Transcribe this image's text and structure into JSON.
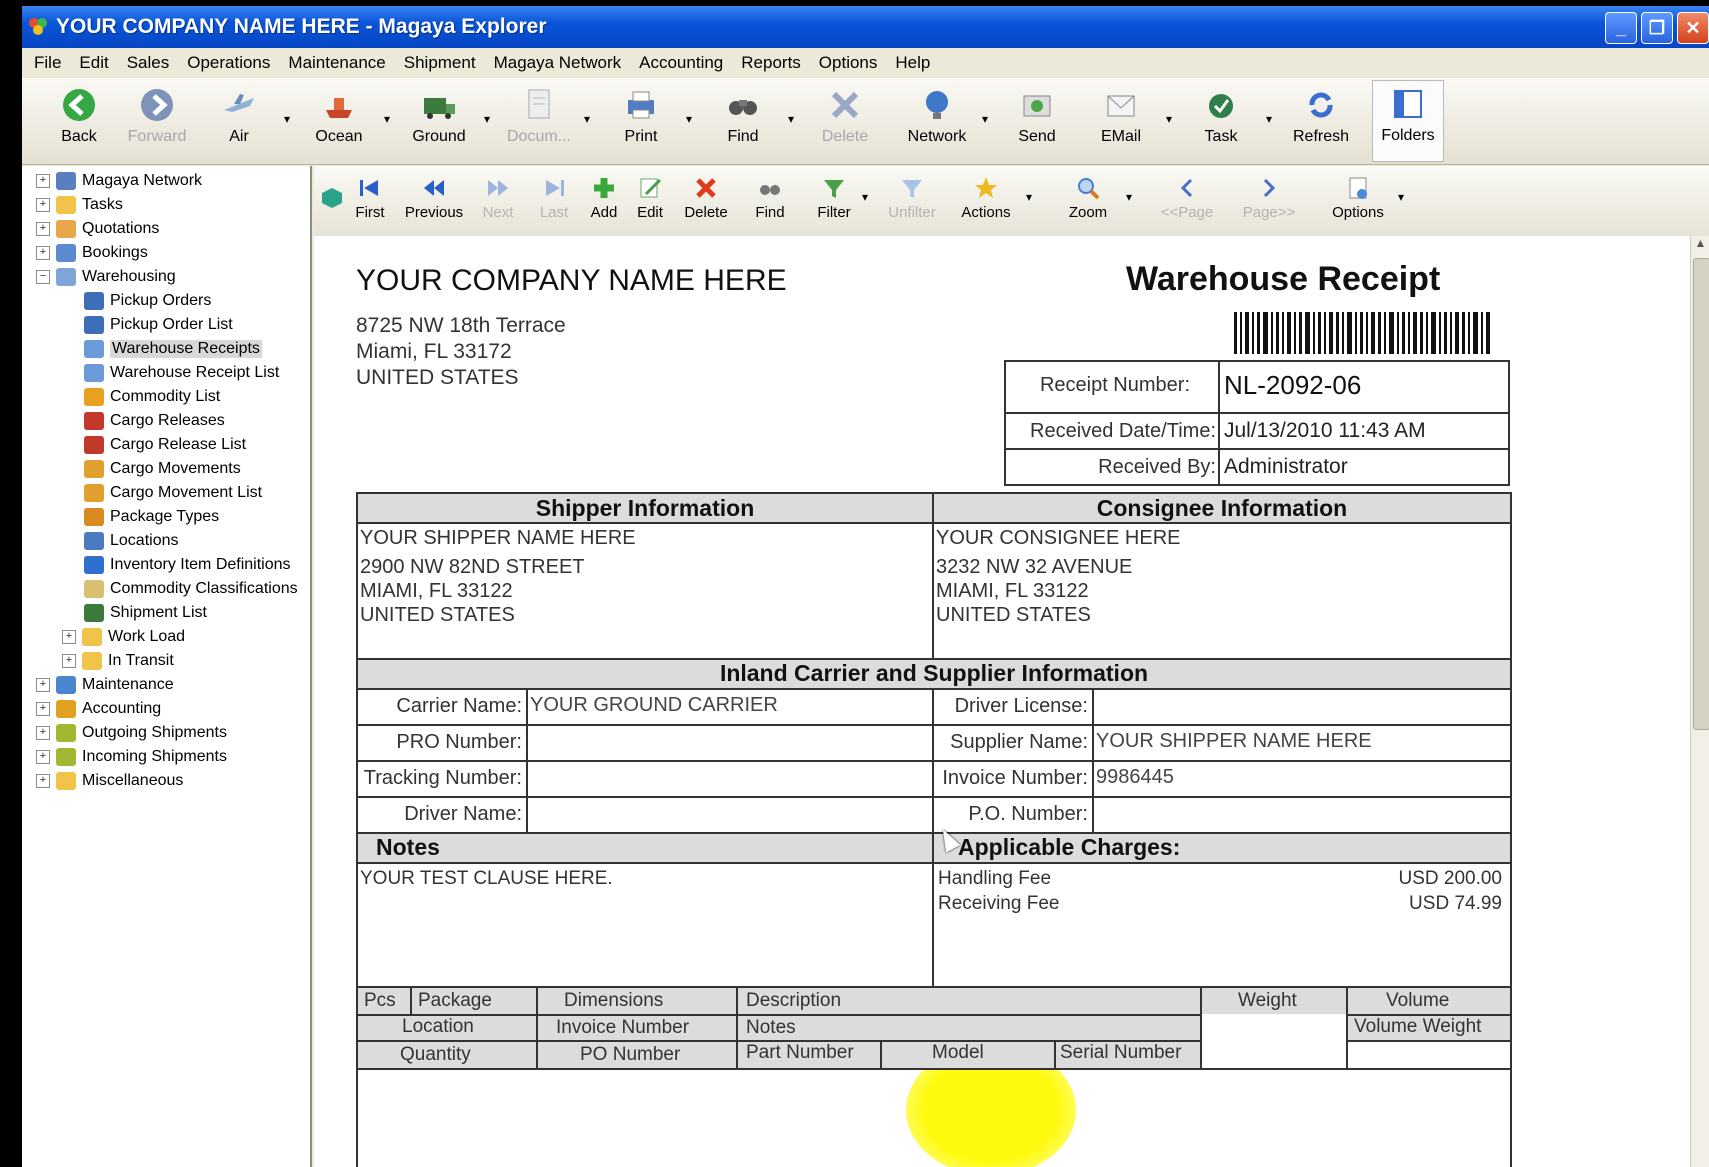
{
  "window": {
    "title": "YOUR COMPANY NAME HERE - Magaya Explorer"
  },
  "menu": [
    "File",
    "Edit",
    "Sales",
    "Operations",
    "Maintenance",
    "Shipment",
    "Magaya Network",
    "Accounting",
    "Reports",
    "Options",
    "Help"
  ],
  "toolbar": {
    "back": "Back",
    "forward": "Forward",
    "air": "Air",
    "ocean": "Ocean",
    "ground": "Ground",
    "documents": "Docum...",
    "print": "Print",
    "find": "Find",
    "delete": "Delete",
    "network": "Network",
    "send": "Send",
    "email": "EMail",
    "task": "Task",
    "refresh": "Refresh",
    "folders": "Folders"
  },
  "sidebar": {
    "items": [
      {
        "label": "Magaya Network"
      },
      {
        "label": "Tasks"
      },
      {
        "label": "Quotations"
      },
      {
        "label": "Bookings"
      },
      {
        "label": "Warehousing"
      },
      {
        "label": "Pickup Orders"
      },
      {
        "label": "Pickup Order List"
      },
      {
        "label": "Warehouse Receipts"
      },
      {
        "label": "Warehouse Receipt List"
      },
      {
        "label": "Commodity List"
      },
      {
        "label": "Cargo Releases"
      },
      {
        "label": "Cargo Release List"
      },
      {
        "label": "Cargo Movements"
      },
      {
        "label": "Cargo Movement List"
      },
      {
        "label": "Package Types"
      },
      {
        "label": "Locations"
      },
      {
        "label": "Inventory Item Definitions"
      },
      {
        "label": "Commodity Classifications"
      },
      {
        "label": "Shipment List"
      },
      {
        "label": "Work Load"
      },
      {
        "label": "In Transit"
      },
      {
        "label": "Maintenance"
      },
      {
        "label": "Accounting"
      },
      {
        "label": "Outgoing Shipments"
      },
      {
        "label": "Incoming Shipments"
      },
      {
        "label": "Miscellaneous"
      }
    ]
  },
  "report_toolbar": {
    "first": "First",
    "previous": "Previous",
    "next": "Next",
    "last": "Last",
    "add": "Add",
    "edit": "Edit",
    "delete": "Delete",
    "find": "Find",
    "filter": "Filter",
    "unfilter": "Unfilter",
    "actions": "Actions",
    "zoom": "Zoom",
    "prev_page": "<<Page",
    "next_page": "Page>>",
    "options": "Options"
  },
  "document": {
    "company_name": "YOUR COMPANY NAME HERE",
    "company_addr1": "8725 NW 18th Terrace",
    "company_addr2": "Miami, FL 33172",
    "company_addr3": "UNITED STATES",
    "title": "Warehouse Receipt",
    "receipt_number_label": "Receipt Number:",
    "receipt_number": "NL-2092-06",
    "received_dt_label": "Received Date/Time:",
    "received_dt": "Jul/13/2010  11:43 AM",
    "received_by_label": "Received By:",
    "received_by": "Administrator",
    "shipper_title": "Shipper Information",
    "shipper_name": "YOUR SHIPPER NAME HERE",
    "shipper_addr1": "2900 NW 82ND STREET",
    "shipper_addr2": "MIAMI, FL 33122",
    "shipper_addr3": "UNITED STATES",
    "consignee_title": "Consignee Information",
    "consignee_name": "YOUR CONSIGNEE HERE",
    "consignee_addr1": "3232 NW 32 AVENUE",
    "consignee_addr2": "MIAMI, FL 33122",
    "consignee_addr3": "UNITED STATES",
    "inland_title": "Inland Carrier and Supplier Information",
    "carrier_name_label": "Carrier Name:",
    "carrier_name": "YOUR GROUND CARRIER",
    "pro_number_label": "PRO Number:",
    "tracking_number_label": "Tracking Number:",
    "driver_name_label": "Driver Name:",
    "driver_license_label": "Driver License:",
    "supplier_name_label": "Supplier Name:",
    "supplier_name": "YOUR SHIPPER NAME HERE",
    "invoice_number_label": "Invoice Number:",
    "invoice_number": "9986445",
    "po_number_label": "P.O. Number:",
    "notes_title": "Notes",
    "notes_text": "YOUR TEST CLAUSE HERE.",
    "charges_title": "Applicable Charges:",
    "charges": [
      {
        "name": "Handling Fee",
        "amount": "USD 200.00"
      },
      {
        "name": "Receiving Fee",
        "amount": "USD 74.99"
      }
    ],
    "grid": {
      "pcs": "Pcs",
      "package": "Package",
      "dimensions": "Dimensions",
      "description": "Description",
      "weight": "Weight",
      "volume": "Volume",
      "location": "Location",
      "invoice_number": "Invoice Number",
      "notes": "Notes",
      "volume_weight": "Volume Weight",
      "quantity": "Quantity",
      "po_number": "PO Number",
      "part_number": "Part Number",
      "model": "Model",
      "serial_number": "Serial Number"
    }
  }
}
